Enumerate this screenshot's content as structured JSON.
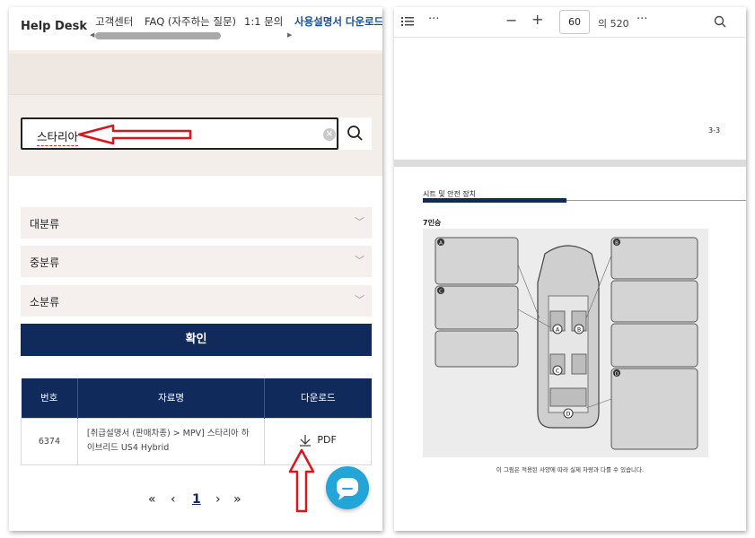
{
  "left": {
    "brand": "Help Desk",
    "nav": [
      {
        "label": "고객센터"
      },
      {
        "label": "FAQ (자주하는 질문)"
      },
      {
        "label": "1:1 문의"
      },
      {
        "label": "사용설명서 다운로드"
      }
    ],
    "search": {
      "value": "스타리아"
    },
    "categories": [
      {
        "label": "대분류"
      },
      {
        "label": "중분류"
      },
      {
        "label": "소분류"
      }
    ],
    "confirm_label": "확인",
    "table": {
      "headers": [
        "번호",
        "자료명",
        "다운로드"
      ],
      "rows": [
        {
          "num": "6374",
          "title_line1": "[취급설명서 (판매차종) > MPV] 스타리아 하",
          "title_line2": "이브리드 US4 Hybrid",
          "download": "PDF"
        }
      ]
    },
    "pager": {
      "first": "«",
      "prev": "‹",
      "current": "1",
      "next": "›",
      "last": "»"
    },
    "colors": {
      "navy": "#0f2a5b",
      "beige": "#f3eeea",
      "chat": "#24a5d8",
      "annotation_red": "#d9161c"
    }
  },
  "right": {
    "toolbar": {
      "page": "60",
      "total": "의 520",
      "minus": "−",
      "plus": "+",
      "more": "···"
    },
    "prev_page_number": "3-3",
    "section_title": "시트 및 안전 장치",
    "seat_config": "7인승",
    "caption": "이 그림은 적용된 사양에 따라 실제 차량과 다를 수 있습니다.",
    "diagram_labels": [
      "A",
      "B",
      "C",
      "D"
    ]
  }
}
